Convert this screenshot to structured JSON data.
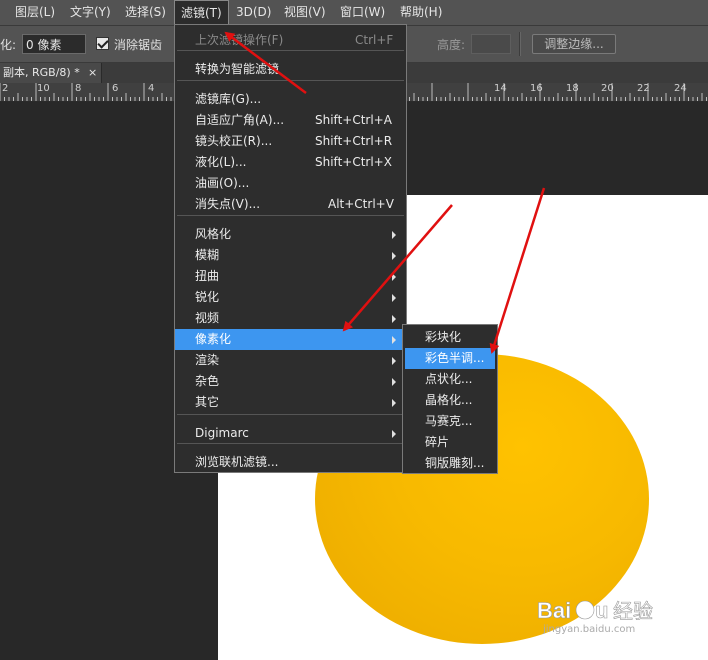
{
  "menubar": [
    "图层(L)",
    "文字(Y)",
    "选择(S)",
    "滤镜(T)",
    "3D(D)",
    "视图(V)",
    "窗口(W)",
    "帮助(H)"
  ],
  "options": {
    "feather_label": "化:",
    "feather_value": "0 像素",
    "antialias_label": "消除锯齿",
    "height_label": "高度:",
    "refine_button": "调整边缘..."
  },
  "document_tab": {
    "title": "副本, RGB/8) *",
    "close": "×"
  },
  "ruler": [
    "2",
    "10",
    "8",
    "6",
    "4",
    "14",
    "16",
    "18",
    "20",
    "22",
    "24"
  ],
  "filter_menu": {
    "items": [
      {
        "label": "上次滤镜操作(F)",
        "shortcut": "Ctrl+F",
        "disabled": true
      },
      {
        "label": "转换为智能滤镜"
      },
      {
        "label": "滤镜库(G)..."
      },
      {
        "label": "自适应广角(A)...",
        "shortcut": "Shift+Ctrl+A"
      },
      {
        "label": "镜头校正(R)...",
        "shortcut": "Shift+Ctrl+R"
      },
      {
        "label": "液化(L)...",
        "shortcut": "Shift+Ctrl+X"
      },
      {
        "label": "油画(O)..."
      },
      {
        "label": "消失点(V)...",
        "shortcut": "Alt+Ctrl+V"
      },
      {
        "label": "风格化",
        "submenu": true
      },
      {
        "label": "模糊",
        "submenu": true
      },
      {
        "label": "扭曲",
        "submenu": true
      },
      {
        "label": "锐化",
        "submenu": true
      },
      {
        "label": "视频",
        "submenu": true
      },
      {
        "label": "像素化",
        "submenu": true,
        "highlighted": true
      },
      {
        "label": "渲染",
        "submenu": true
      },
      {
        "label": "杂色",
        "submenu": true
      },
      {
        "label": "其它",
        "submenu": true
      },
      {
        "label": "Digimarc",
        "submenu": true
      },
      {
        "label": "浏览联机滤镜..."
      }
    ]
  },
  "pixelate_submenu": {
    "items": [
      {
        "label": "彩块化"
      },
      {
        "label": "彩色半调...",
        "highlighted": true
      },
      {
        "label": "点状化..."
      },
      {
        "label": "晶格化..."
      },
      {
        "label": "马赛克..."
      },
      {
        "label": "碎片"
      },
      {
        "label": "铜版雕刻..."
      }
    ]
  },
  "watermark": {
    "brand": "Baidu",
    "cn": "经验",
    "url": "jingyan.baidu.com"
  },
  "colors": {
    "highlight": "#3d96f0",
    "arrow": "#e01010",
    "ellipse": "#f7b900"
  }
}
